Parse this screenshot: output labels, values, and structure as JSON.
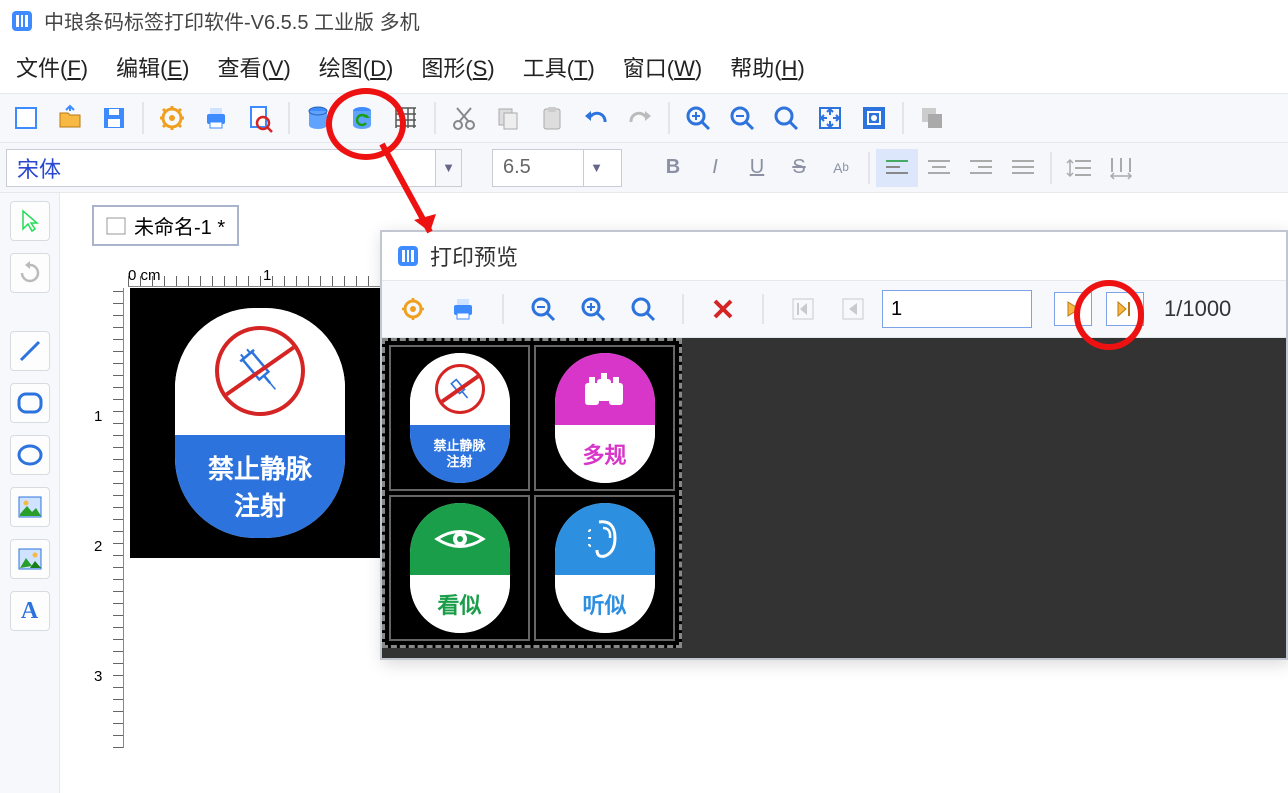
{
  "app": {
    "title": "中琅条码标签打印软件-V6.5.5 工业版 多机"
  },
  "menu": {
    "file": "文件(<u>F</u>)",
    "edit": "编辑(<u>E</u>)",
    "view": "查看(<u>V</u>)",
    "draw": "绘图(<u>D</u>)",
    "shape": "图形(<u>S</u>)",
    "tool": "工具(<u>T</u>)",
    "window": "窗口(<u>W</u>)",
    "help": "帮助(<u>H</u>)"
  },
  "font": {
    "name": "宋体",
    "size": "6.5"
  },
  "doc": {
    "tab": "未命名-1 *"
  },
  "ruler": {
    "u0": "0 cm",
    "u1": "1",
    "v1": "1",
    "v2": "2",
    "v3": "3"
  },
  "main_label": {
    "line1": "禁止静脉",
    "line2": "注射"
  },
  "preview": {
    "title": "打印预览",
    "page_value": "1",
    "page_total": "1/1000",
    "cells": {
      "a": {
        "line1": "禁止静脉",
        "line2": "注射"
      },
      "b": "多规",
      "c": "看似",
      "d": "听似"
    }
  }
}
